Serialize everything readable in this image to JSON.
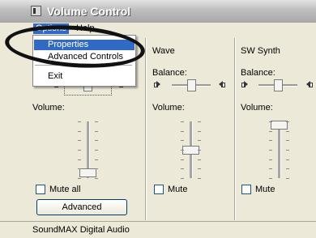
{
  "window": {
    "title": "Volume Control"
  },
  "menubar": {
    "options": "Options",
    "help": "Help"
  },
  "options_menu": {
    "items": [
      "Properties",
      "Advanced Controls",
      "Exit"
    ],
    "selected": "Properties"
  },
  "master": {
    "volume_label": "Volume:",
    "mute_label": "Mute all",
    "mute_checked": false,
    "advanced_label": "Advanced",
    "balance": 0.5,
    "volume_level": 0.1
  },
  "wave": {
    "name": "Wave",
    "balance_label": "Balance:",
    "volume_label": "Volume:",
    "mute_label": "Mute",
    "mute_checked": false,
    "balance": 0.5,
    "volume_level": 0.5
  },
  "synth": {
    "name": "SW Synth",
    "balance_label": "Balance:",
    "volume_label": "Volume:",
    "mute_label": "Mute",
    "mute_checked": false,
    "balance": 0.5,
    "volume_level": 0.95
  },
  "status": {
    "device": "SoundMAX Digital Audio"
  },
  "colors": {
    "selection": "#316ac5",
    "face": "#ece9d8",
    "annotation": "#111111"
  }
}
